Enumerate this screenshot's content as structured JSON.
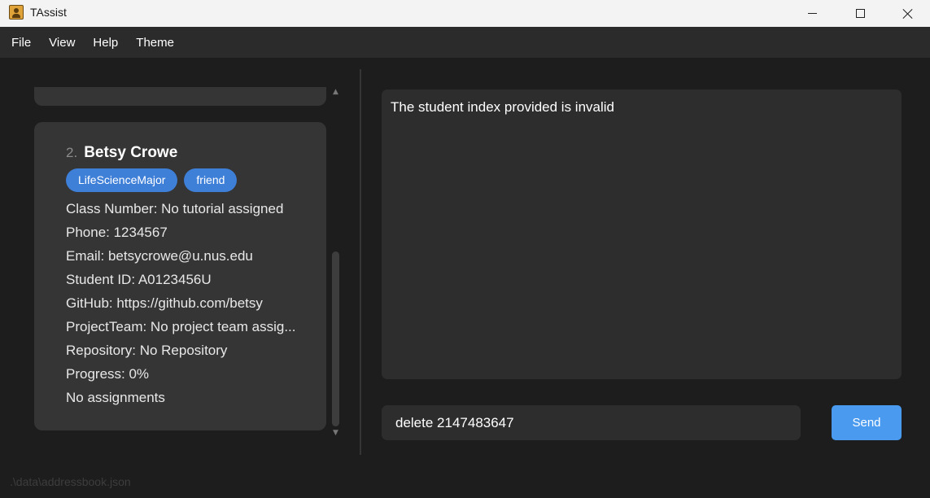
{
  "window": {
    "title": "TAssist",
    "icon": "person-badge-icon"
  },
  "menu": {
    "items": [
      {
        "label": "File"
      },
      {
        "label": "View"
      },
      {
        "label": "Help"
      },
      {
        "label": "Theme"
      }
    ]
  },
  "student": {
    "index": "2.",
    "name": "Betsy Crowe",
    "tags": [
      "LifeScienceMajor",
      "friend"
    ],
    "fields": [
      "Class Number: No tutorial assigned",
      "Phone: 1234567",
      "Email: betsycrowe@u.nus.edu",
      "Student ID: A0123456U",
      "GitHub: https://github.com/betsy",
      "ProjectTeam: No project team assig...",
      "Repository: No Repository",
      "Progress: 0%",
      "No assignments"
    ]
  },
  "result": {
    "message": "The student index provided is invalid"
  },
  "command": {
    "value": "delete 2147483647",
    "send_label": "Send"
  },
  "status": {
    "path": ".\\data\\addressbook.json"
  },
  "colors": {
    "tag": "#3e7fd8",
    "accent": "#4a9af0",
    "background": "#1d1d1d",
    "panel": "#2d2d2d"
  }
}
